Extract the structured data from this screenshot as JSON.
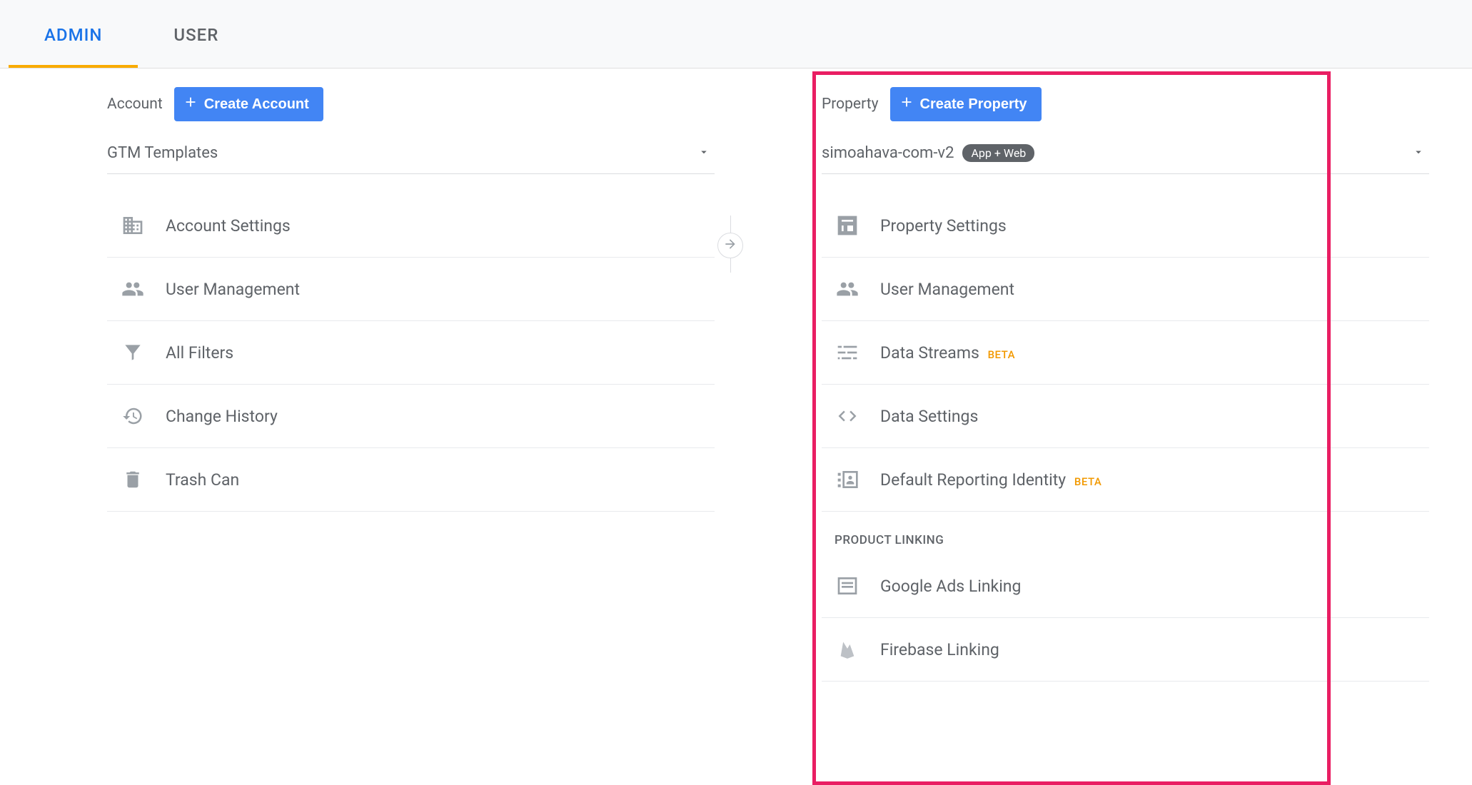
{
  "tabs": {
    "admin": "ADMIN",
    "user": "USER"
  },
  "account": {
    "label": "Account",
    "create_label": "Create Account",
    "selector_text": "GTM Templates",
    "items": [
      {
        "label": "Account Settings"
      },
      {
        "label": "User Management"
      },
      {
        "label": "All Filters"
      },
      {
        "label": "Change History"
      },
      {
        "label": "Trash Can"
      }
    ]
  },
  "property": {
    "label": "Property",
    "create_label": "Create Property",
    "selector_text": "simoahava-com-v2",
    "badge": "App + Web",
    "group_header": "PRODUCT LINKING",
    "beta_tag": "BETA",
    "items": [
      {
        "label": "Property Settings"
      },
      {
        "label": "User Management"
      },
      {
        "label": "Data Streams",
        "beta": true
      },
      {
        "label": "Data Settings"
      },
      {
        "label": "Default Reporting Identity",
        "beta": true
      }
    ],
    "linking": [
      {
        "label": "Google Ads Linking"
      },
      {
        "label": "Firebase Linking"
      }
    ]
  }
}
